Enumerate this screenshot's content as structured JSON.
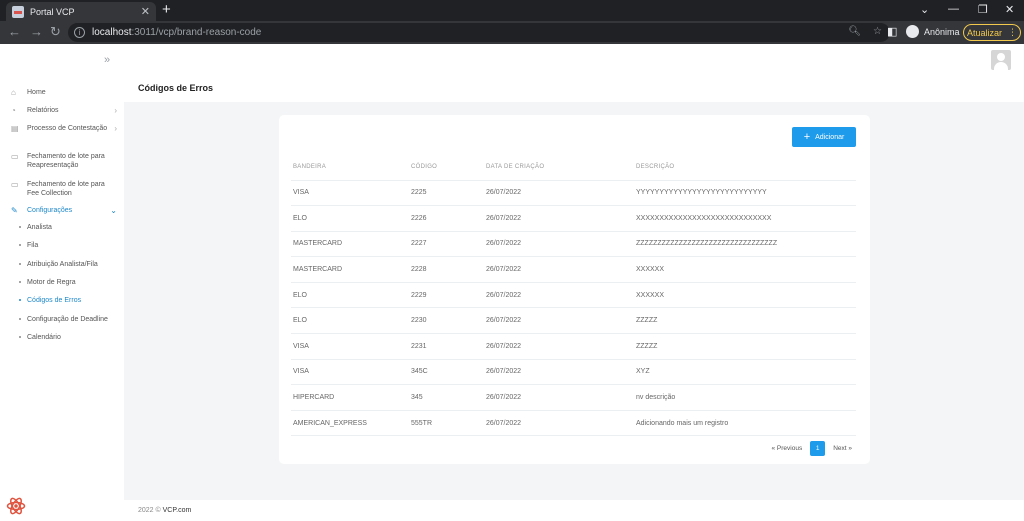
{
  "browser": {
    "tab_title": "Portal VCP",
    "tab_close": "✕",
    "new_tab": "+",
    "url_host": "localhost",
    "url_path": ":3011/vcp/brand-reason-code",
    "profile_name": "Anônima",
    "update_label": "Atualizar"
  },
  "sidebar": {
    "items": [
      {
        "label": "Home",
        "icon": "home-icon"
      },
      {
        "label": "Relatórios",
        "icon": "chart-icon"
      },
      {
        "label": "Processo de Contestação",
        "icon": "folder-icon"
      },
      {
        "label": "Fechamento de lote para Reapresentação",
        "icon": "card-icon"
      },
      {
        "label": "Fechamento de lote para Fee Collection",
        "icon": "card-icon"
      },
      {
        "label": "Configurações",
        "icon": "wrench-icon"
      }
    ],
    "sub_items": [
      "Analista",
      "Fila",
      "Atribuição Analista/Fila",
      "Motor de Regra",
      "Códigos de Erros",
      "Configuração de Deadline",
      "Calendário"
    ]
  },
  "page": {
    "title": "Códigos de Erros",
    "add_button": "Adicionar"
  },
  "table": {
    "headers": [
      "BANDEIRA",
      "CÓDIGO",
      "DATA DE CRIAÇÃO",
      "DESCRIÇÃO"
    ],
    "rows": [
      [
        "VISA",
        "2225",
        "26/07/2022",
        "YYYYYYYYYYYYYYYYYYYYYYYYYYYY"
      ],
      [
        "ELO",
        "2226",
        "26/07/2022",
        "XXXXXXXXXXXXXXXXXXXXXXXXXXXXX"
      ],
      [
        "MASTERCARD",
        "2227",
        "26/07/2022",
        "ZZZZZZZZZZZZZZZZZZZZZZZZZZZZZZZZZ"
      ],
      [
        "MASTERCARD",
        "2228",
        "26/07/2022",
        "XXXXXX"
      ],
      [
        "ELO",
        "2229",
        "26/07/2022",
        "XXXXXX"
      ],
      [
        "ELO",
        "2230",
        "26/07/2022",
        "ZZZZZ"
      ],
      [
        "VISA",
        "2231",
        "26/07/2022",
        "ZZZZZ"
      ],
      [
        "VISA",
        "345C",
        "26/07/2022",
        "XYZ"
      ],
      [
        "HIPERCARD",
        "345",
        "26/07/2022",
        "nv descrição"
      ],
      [
        "AMERICAN_EXPRESS",
        "555TR",
        "26/07/2022",
        "Adicionando mais um registro"
      ]
    ]
  },
  "pagination": {
    "previous": "« Previous",
    "current": "1",
    "next": "Next »"
  },
  "footer": {
    "year": "2022 ©",
    "brand": "VCP.com"
  },
  "colors": {
    "accent": "#1e9bea",
    "active_nav": "#1e88c9"
  }
}
